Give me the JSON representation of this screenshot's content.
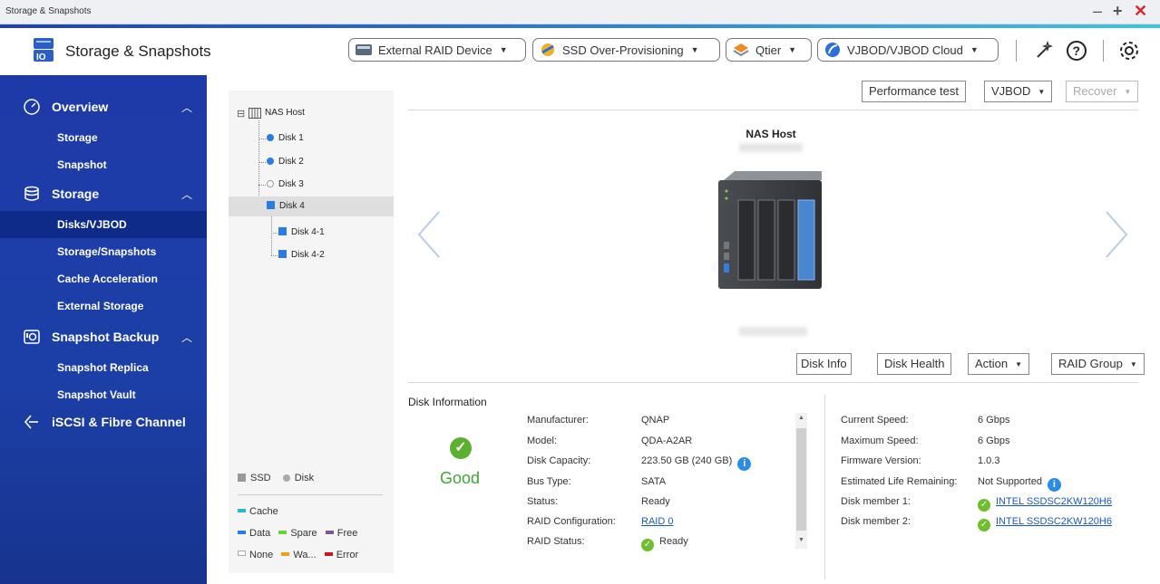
{
  "window": {
    "title": "Storage & Snapshots"
  },
  "header": {
    "app_title": "Storage & Snapshots",
    "buttons": [
      {
        "label": "External RAID Device"
      },
      {
        "label": "SSD Over-Provisioning"
      },
      {
        "label": "Qtier"
      },
      {
        "label": "VJBOD/VJBOD Cloud"
      }
    ]
  },
  "sidebar": {
    "sections": [
      {
        "label": "Overview",
        "items": [
          {
            "label": "Storage"
          },
          {
            "label": "Snapshot"
          }
        ]
      },
      {
        "label": "Storage",
        "items": [
          {
            "label": "Disks/VJBOD",
            "active": true
          },
          {
            "label": "Storage/Snapshots"
          },
          {
            "label": "Cache Acceleration"
          },
          {
            "label": "External Storage"
          }
        ]
      },
      {
        "label": "Snapshot Backup",
        "items": [
          {
            "label": "Snapshot Replica"
          },
          {
            "label": "Snapshot Vault"
          }
        ]
      },
      {
        "label": "iSCSI & Fibre Channel",
        "items": []
      }
    ]
  },
  "tree": {
    "root": "NAS Host",
    "disks": [
      {
        "label": "Disk 1",
        "type": "disk",
        "color": "#2b7be0"
      },
      {
        "label": "Disk 2",
        "type": "disk",
        "color": "#2b7be0"
      },
      {
        "label": "Disk 3",
        "type": "empty"
      },
      {
        "label": "Disk 4",
        "type": "ssd",
        "color": "#2b7be0",
        "selected": true,
        "children": [
          "Disk 4-1",
          "Disk 4-2"
        ]
      }
    ],
    "legend": {
      "types": [
        "SSD",
        "Disk"
      ],
      "roles": [
        {
          "label": "Cache",
          "color": "#2ab8d0"
        },
        {
          "label": "Data",
          "color": "#2b7be0"
        },
        {
          "label": "Spare",
          "color": "#6bd03a"
        },
        {
          "label": "Free",
          "color": "#7a5a90"
        },
        {
          "label": "None",
          "color": "#ffffff"
        },
        {
          "label": "Wa...",
          "color": "#f39c1f"
        },
        {
          "label": "Error",
          "color": "#c9171e"
        }
      ]
    }
  },
  "toolbar": {
    "performance_test": "Performance test",
    "vjbod": "VJBOD",
    "recover": "Recover"
  },
  "device": {
    "name": "NAS Host"
  },
  "disk_actions": {
    "disk_info": "Disk Info",
    "disk_health": "Disk Health",
    "action": "Action",
    "raid_group": "RAID Group"
  },
  "disk_info": {
    "section_title": "Disk Information",
    "status_text": "Good",
    "left": [
      {
        "label": "Manufacturer:",
        "value": "QNAP"
      },
      {
        "label": "Model:",
        "value": "QDA-A2AR"
      },
      {
        "label": "Disk Capacity:",
        "value": "223.50 GB (240 GB)"
      },
      {
        "label": "Bus Type:",
        "value": "SATA"
      },
      {
        "label": "Status:",
        "value": "Ready"
      },
      {
        "label": "RAID Configuration:",
        "value": "RAID 0"
      },
      {
        "label": "RAID Status:",
        "value": "Ready"
      }
    ],
    "right": [
      {
        "label": "Current Speed:",
        "value": "6 Gbps"
      },
      {
        "label": "Maximum Speed:",
        "value": "6 Gbps"
      },
      {
        "label": "Firmware Version:",
        "value": "1.0.3"
      },
      {
        "label": "Estimated Life Remaining:",
        "value": "Not Supported"
      },
      {
        "label": "Disk member 1:",
        "value": "INTEL SSDSC2KW120H6"
      },
      {
        "label": "Disk member 2:",
        "value": "INTEL SSDSC2KW120H6"
      }
    ]
  },
  "colors": {
    "sidebar": "#1e3aa8",
    "accent_start": "#1f3fb8",
    "accent_end": "#3dc8d8",
    "good": "#3fa535",
    "link": "#1a55d0"
  }
}
